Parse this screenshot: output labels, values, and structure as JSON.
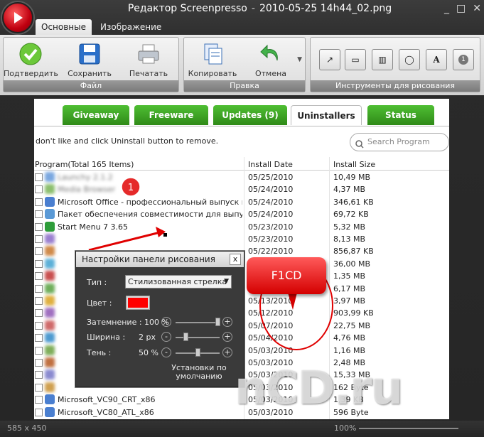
{
  "window": {
    "title": "Редактор Screenpresso",
    "filename": "2010-05-25 14h44_02.png",
    "controls": [
      "_",
      "□",
      "✕"
    ]
  },
  "ribbon_tabs": [
    {
      "label": "Основные",
      "active": true
    },
    {
      "label": "Изображение",
      "active": false
    }
  ],
  "ribbon": {
    "file_group": {
      "label": "Файл",
      "buttons": [
        {
          "label": "Подтвердить",
          "icon": "check-icon"
        },
        {
          "label": "Сохранить",
          "icon": "floppy-icon"
        },
        {
          "label": "Печатать",
          "icon": "printer-icon"
        }
      ]
    },
    "edit_group": {
      "label": "Правка",
      "buttons": [
        {
          "label": "Копировать",
          "icon": "copy-icon"
        },
        {
          "label": "Отмена",
          "icon": "undo-icon"
        }
      ]
    },
    "tools_group": {
      "label": "Инструменты для рисования",
      "tools": [
        {
          "icon": "arrow-tool-icon",
          "glyph": "↗"
        },
        {
          "icon": "rectangle-tool-icon",
          "glyph": "▭"
        },
        {
          "icon": "blur-tool-icon",
          "glyph": "▥"
        },
        {
          "icon": "ellipse-tool-icon",
          "glyph": "◯"
        },
        {
          "icon": "text-tool-icon",
          "glyph": "A"
        },
        {
          "icon": "number-tool-icon",
          "glyph": "1"
        }
      ]
    }
  },
  "screenshot": {
    "tabs": [
      "Giveaway",
      "Freeware",
      "Updates (9)",
      "Uninstallers",
      "Status"
    ],
    "selected_tab": "Uninstallers",
    "info_text": "don't like and click Uninstall button to remove.",
    "search_placeholder": "Search Program",
    "columns": [
      "Program(Total 165 Items)",
      "Install Date",
      "Install Size"
    ],
    "rows": [
      {
        "name": "Launchy 2.1.2",
        "date": "05/25/2010",
        "size": "10,49 MB",
        "blurred": true
      },
      {
        "name": "Media Browser",
        "date": "05/24/2010",
        "size": "4,37 MB",
        "blurred": true
      },
      {
        "name": "Microsoft Office - профессиональный выпуск вер...",
        "date": "05/24/2010",
        "size": "346,61 KB",
        "blurred": false
      },
      {
        "name": "Пакет обеспечения совместимости для выпуска...",
        "date": "05/24/2010",
        "size": "69,72 KB",
        "blurred": false
      },
      {
        "name": "Start Menu 7 3.65",
        "date": "05/23/2010",
        "size": "5,32 MB",
        "blurred": false
      },
      {
        "name": "",
        "date": "05/23/2010",
        "size": "8,13 MB",
        "blurred": true
      },
      {
        "name": "",
        "date": "05/22/2010",
        "size": "856,87 KB",
        "blurred": true
      },
      {
        "name": "",
        "date": "",
        "size": "36,00 MB",
        "blurred": true
      },
      {
        "name": "",
        "date": "",
        "size": "1,35 MB",
        "blurred": true
      },
      {
        "name": "",
        "date": "",
        "size": "6,17 MB",
        "blurred": true
      },
      {
        "name": "",
        "date": "05/13/2010",
        "size": "3,97 MB",
        "blurred": true
      },
      {
        "name": "",
        "date": "05/12/2010",
        "size": "903,99 KB",
        "blurred": true
      },
      {
        "name": "",
        "date": "05/07/2010",
        "size": "22,75 MB",
        "blurred": true
      },
      {
        "name": "",
        "date": "05/04/2010",
        "size": "4,76 MB",
        "blurred": true
      },
      {
        "name": "",
        "date": "05/03/2010",
        "size": "1,16 MB",
        "blurred": true
      },
      {
        "name": "",
        "date": "05/03/2010",
        "size": "2,48 MB",
        "blurred": true
      },
      {
        "name": "",
        "date": "05/03/2010",
        "size": "15,33 MB",
        "blurred": true
      },
      {
        "name": "",
        "date": "05/03/2010",
        "size": "162 Byte",
        "blurred": true
      },
      {
        "name": "Microsoft_VC90_CRT_x86",
        "date": "05/03/2010",
        "size": "1,39 KB",
        "blurred": false
      },
      {
        "name": "Microsoft_VC80_ATL_x86",
        "date": "05/03/2010",
        "size": "596 Byte",
        "blurred": false
      }
    ]
  },
  "dialog": {
    "title": "Настройки панели рисования",
    "close": "x",
    "type_label": "Тип :",
    "type_value": "Стилизованная стрелка",
    "color_label": "Цвет :",
    "color_value": "#ff0000",
    "opacity_label": "Затемнение : 100 %",
    "opacity_level": 1.0,
    "width_label": "Ширина :",
    "width_value": "2 px",
    "width_level": 0.2,
    "shadow_label": "Тень :",
    "shadow_value": "50 %",
    "shadow_level": 0.5,
    "defaults_link": "Установки по умолчанию"
  },
  "annotations": {
    "number_marker": "1",
    "callout_text": "F1CD",
    "accent_color": "#e00000"
  },
  "status": {
    "image_size": "585 x 450",
    "zoom": "100%"
  },
  "watermark": "iXBT-style",
  "watermark_text": "nCD.ru"
}
